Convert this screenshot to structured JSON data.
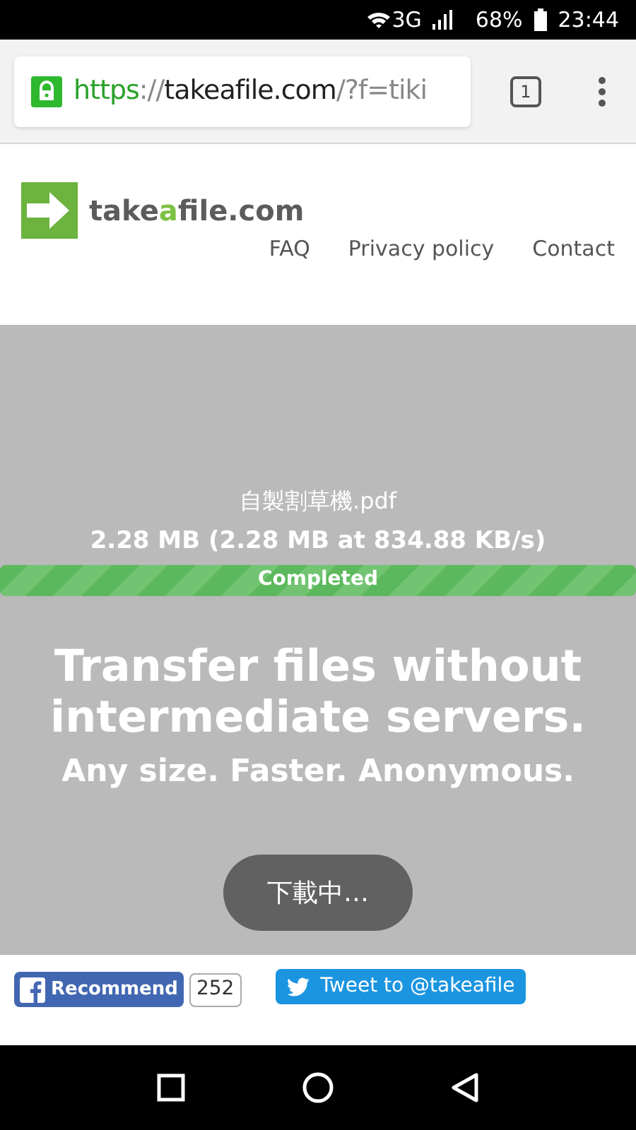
{
  "status_bar": {
    "network": "3G",
    "battery": "68%",
    "time": "23:44"
  },
  "browser": {
    "url": {
      "scheme": "https",
      "separator": "://",
      "host": "takeafile.com",
      "path": "/?f=tiki"
    },
    "tab_count": "1"
  },
  "site": {
    "logo": {
      "start": "take",
      "accent": "a",
      "end": "file.com"
    },
    "nav": [
      "FAQ",
      "Privacy policy",
      "Contact"
    ]
  },
  "transfer": {
    "file_name": "自製割草機.pdf",
    "size": "2.28 MB (2.28 MB at 834.88 KB/s)",
    "progress": {
      "label": "Completed",
      "level": 1
    }
  },
  "hero": {
    "title": "Transfer files without intermediate servers.",
    "subtitle": "Any size. Faster. Anonymous."
  },
  "toast": "下載中…",
  "social": {
    "recommend": "Recommend",
    "count": "252",
    "tweet": "Tweet to @takeafile"
  }
}
